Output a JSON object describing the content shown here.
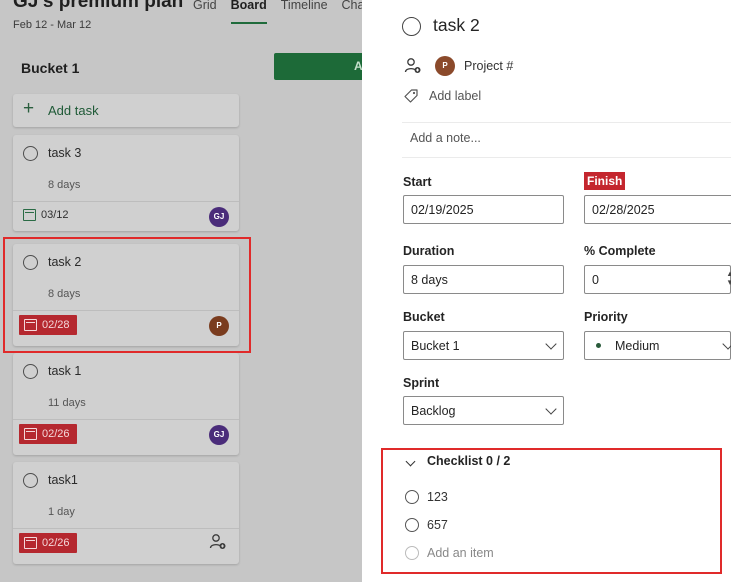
{
  "board": {
    "plan_title": "GJ's premium plan",
    "plan_dates": "Feb 12 - Mar 12",
    "views": [
      "Grid",
      "Board",
      "Timeline",
      "Cha"
    ],
    "active_view": "Board",
    "bucket_title": "Bucket 1",
    "green_button_label": "A",
    "add_task_label": "Add task",
    "cards": [
      {
        "title": "task 3",
        "duration": "8 days",
        "date": "03/12",
        "date_style": "plain",
        "assignee": "GJ"
      },
      {
        "title": "task 2",
        "duration": "8 days",
        "date": "02/28",
        "date_style": "overdue",
        "assignee": "P"
      },
      {
        "title": "task 1",
        "duration": "11 days",
        "date": "02/26",
        "date_style": "overdue",
        "assignee": "GJ"
      },
      {
        "title": "task1",
        "duration": "1 day",
        "date": "02/26",
        "date_style": "overdue",
        "assignee": ""
      }
    ]
  },
  "panel": {
    "task_title": "task 2",
    "project_avatar": "P",
    "project_label": "Project #",
    "add_label": "Add label",
    "note_placeholder": "Add a note...",
    "start_label": "Start",
    "start_value": "02/19/2025",
    "finish_label": "Finish",
    "finish_value": "02/28/2025",
    "duration_label": "Duration",
    "duration_value": "8 days",
    "complete_label": "% Complete",
    "complete_value": "0",
    "bucket_label": "Bucket",
    "bucket_value": "Bucket 1",
    "priority_label": "Priority",
    "priority_value": "Medium",
    "sprint_label": "Sprint",
    "sprint_value": "Backlog",
    "checklist": {
      "title": "Checklist 0 / 2",
      "items": [
        "123",
        "657"
      ],
      "add_item": "Add an item"
    }
  },
  "colors": {
    "overdue": "#c4262e",
    "brand_green": "#1d6a38",
    "highlight": "#e02a2a"
  }
}
